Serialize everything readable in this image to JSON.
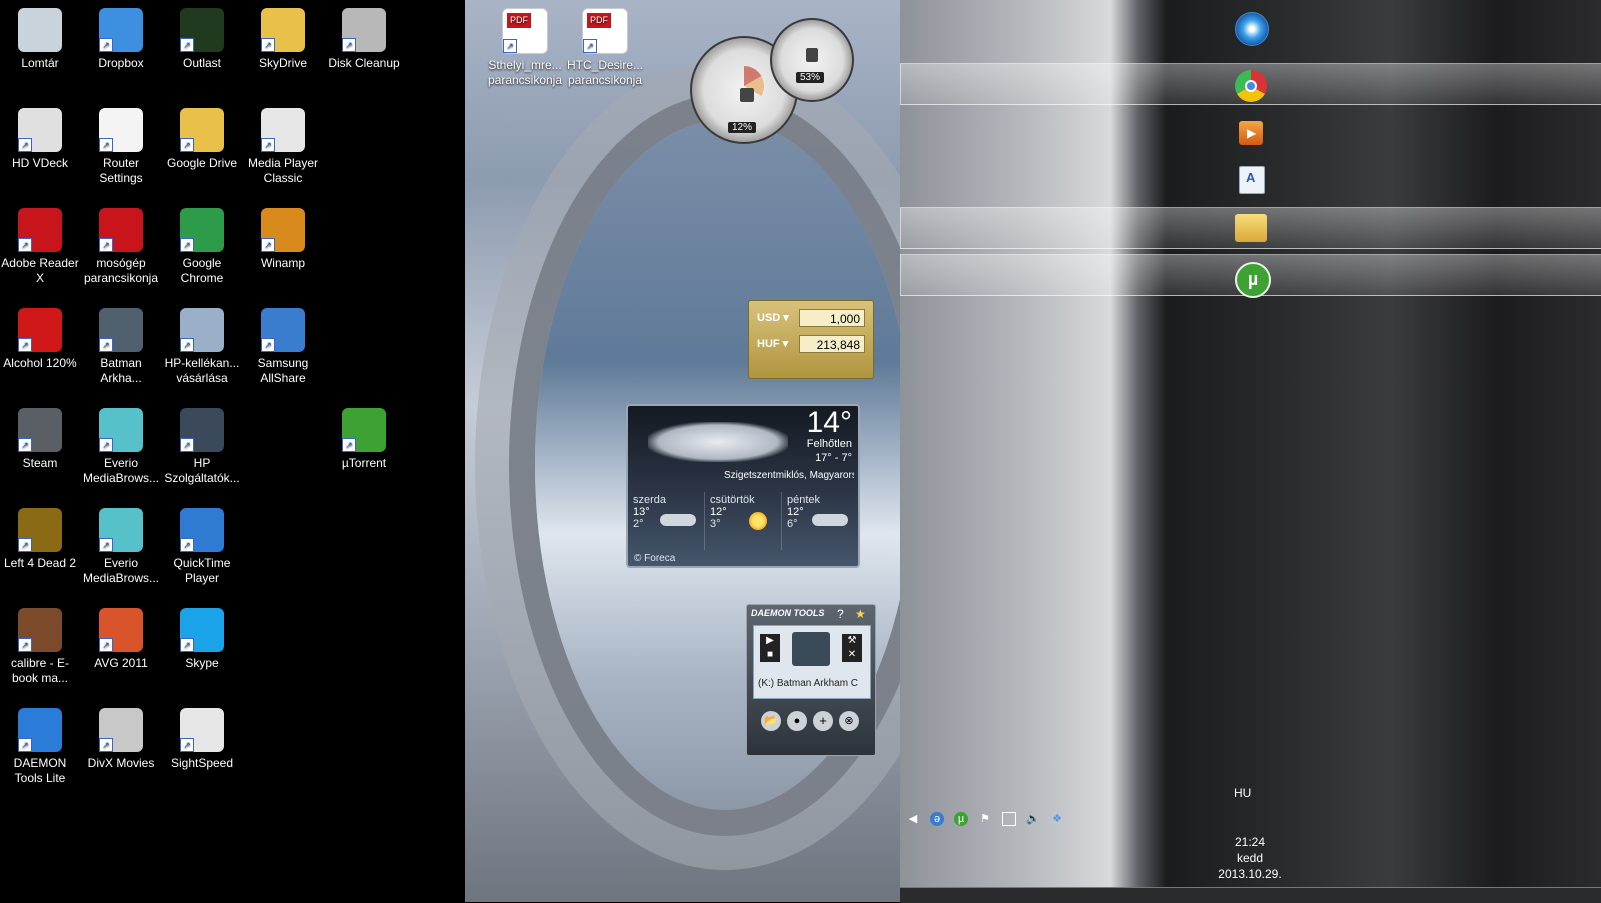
{
  "desktop_icons": [
    {
      "label": "Lomtár",
      "icon": "recycle-bin-icon",
      "color": "#c8d3dc"
    },
    {
      "label": "Dropbox",
      "icon": "dropbox-icon",
      "color": "#3d8fe0"
    },
    {
      "label": "Outlast",
      "icon": "outlast-icon",
      "color": "#203a20"
    },
    {
      "label": "SkyDrive",
      "icon": "skydrive-icon",
      "color": "#e8c04a"
    },
    {
      "label": "Disk Cleanup",
      "icon": "disk-cleanup-icon",
      "color": "#b8b8b8"
    },
    {
      "label": "HD VDeck",
      "icon": "hd-vdeck-icon",
      "color": "#e0e0e0"
    },
    {
      "label": "Router Settings",
      "icon": "document-icon",
      "color": "#f4f4f4"
    },
    {
      "label": "Google Drive",
      "icon": "google-drive-icon",
      "color": "#e8c04a"
    },
    {
      "label": "Media Player Classic",
      "icon": "media-player-classic-icon",
      "color": "#e6e6e6"
    },
    {
      "label": "Adobe Reader X",
      "icon": "adobe-reader-icon",
      "color": "#c8151b"
    },
    {
      "label": "mosógép parancsikonja",
      "icon": "pdf-icon",
      "color": "#c8151b"
    },
    {
      "label": "Google Chrome",
      "icon": "chrome-icon",
      "color": "#2d9b49"
    },
    {
      "label": "Winamp",
      "icon": "winamp-icon",
      "color": "#d98a1c"
    },
    {
      "label": "Alcohol 120%",
      "icon": "alcohol-icon",
      "color": "#d01818"
    },
    {
      "label": "Batman Arkha...",
      "icon": "batman-icon",
      "color": "#50606e"
    },
    {
      "label": "HP-kellékan... vásárlása",
      "icon": "printer-icon",
      "color": "#9ab0c8"
    },
    {
      "label": "Samsung AllShare",
      "icon": "allshare-icon",
      "color": "#3a7ccd"
    },
    {
      "label": "Steam",
      "icon": "steam-icon",
      "color": "#5a5f66"
    },
    {
      "label": "Everio MediaBrows...",
      "icon": "everio-icon",
      "color": "#56c1c8"
    },
    {
      "label": "HP Szolgáltatók...",
      "icon": "hp-icon",
      "color": "#3a4a5a"
    },
    {
      "label": "µTorrent",
      "icon": "utorrent-icon",
      "color": "#3da233"
    },
    {
      "label": "Left 4 Dead 2",
      "icon": "left4dead-icon",
      "color": "#8a6a14"
    },
    {
      "label": "Everio MediaBrows...",
      "icon": "everio-icon",
      "color": "#56c1c8"
    },
    {
      "label": "QuickTime Player",
      "icon": "quicktime-icon",
      "color": "#2f7bd3"
    },
    {
      "label": "calibre - E-book ma...",
      "icon": "calibre-icon",
      "color": "#7a4a2a"
    },
    {
      "label": "AVG 2011",
      "icon": "avg-icon",
      "color": "#d9542b"
    },
    {
      "label": "Skype",
      "icon": "skype-icon",
      "color": "#1aa3e8"
    },
    {
      "label": "DAEMON Tools Lite",
      "icon": "daemon-tools-icon",
      "color": "#2b7bd8"
    },
    {
      "label": "DivX Movies",
      "icon": "divx-icon",
      "color": "#c8c8c8"
    },
    {
      "label": "SightSpeed",
      "icon": "sightspeed-icon",
      "color": "#e6e6e6"
    }
  ],
  "wallpaper_icons": [
    {
      "label": "Sthelyi_mre... parancsikonja",
      "icon": "pdf-icon"
    },
    {
      "label": "HTC_Desire... parancsikonja",
      "icon": "pdf-icon"
    }
  ],
  "cpu_gadget": {
    "cpu": "12%",
    "memory": "53%"
  },
  "currency_gadget": {
    "from_currency": "USD",
    "from_value": "1,000",
    "to_currency": "HUF",
    "to_value": "213,848"
  },
  "weather_gadget": {
    "temperature": "14°",
    "condition": "Felhőtlen",
    "range": "17° - 7°",
    "location": "Szigetszentmiklós, Magyarország",
    "forecast": [
      {
        "day": "szerda",
        "high": "13°",
        "low": "2°",
        "icon": "cloud-icon"
      },
      {
        "day": "csütörtök",
        "high": "12°",
        "low": "3°",
        "icon": "sun-icon"
      },
      {
        "day": "péntek",
        "high": "12°",
        "low": "6°",
        "icon": "cloud-icon"
      }
    ],
    "provider": "© Foreca"
  },
  "daemon_gadget": {
    "logo": "DAEMON TOOLS",
    "help": "?",
    "drive": "(K:) Batman Arkham C"
  },
  "taskbar": {
    "apps": [
      {
        "name": "start-orb-icon"
      },
      {
        "name": "chrome-icon"
      },
      {
        "name": "media-player-icon"
      },
      {
        "name": "document-viewer-icon"
      },
      {
        "name": "explorer-icon"
      },
      {
        "name": "utorrent-icon"
      }
    ],
    "language": "HU",
    "time": "21:24",
    "day": "kedd",
    "date": "2013.10.29.",
    "tray_icons": [
      "chevron-left-icon",
      "allshare-icon",
      "utorrent-icon",
      "flag-icon",
      "network-icon",
      "volume-icon",
      "dropbox-icon"
    ]
  }
}
